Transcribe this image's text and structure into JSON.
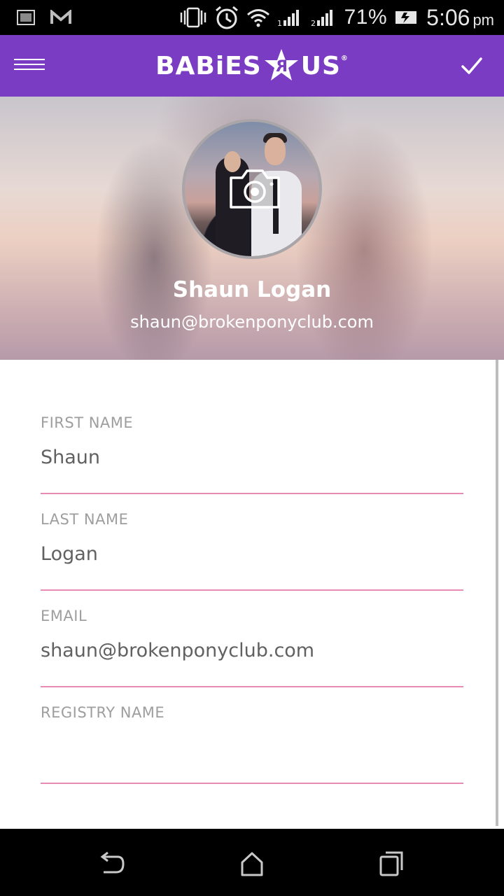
{
  "status_bar": {
    "battery_percent": "71%",
    "time": "5:06",
    "time_suffix": "pm"
  },
  "app_bar": {
    "logo_text_left": "BABiES",
    "logo_text_right": "US",
    "logo_mark": "®",
    "menu_icon": "menu-icon",
    "confirm_icon": "check-icon",
    "bg_color": "#7a3cc2"
  },
  "profile": {
    "name": "Shaun Logan",
    "email": "shaun@brokenponyclub.com",
    "camera_icon": "camera-icon"
  },
  "form": {
    "fields": [
      {
        "label": "FIRST NAME",
        "value": "Shaun"
      },
      {
        "label": "LAST NAME",
        "value": "Logan"
      },
      {
        "label": "EMAIL",
        "value": "shaun@brokenponyclub.com"
      },
      {
        "label": "REGISTRY NAME",
        "value": ""
      }
    ],
    "underline_color": "#e88bb3"
  },
  "nav_bar": {
    "back_icon": "back-icon",
    "home_icon": "home-icon",
    "recents_icon": "recents-icon"
  }
}
